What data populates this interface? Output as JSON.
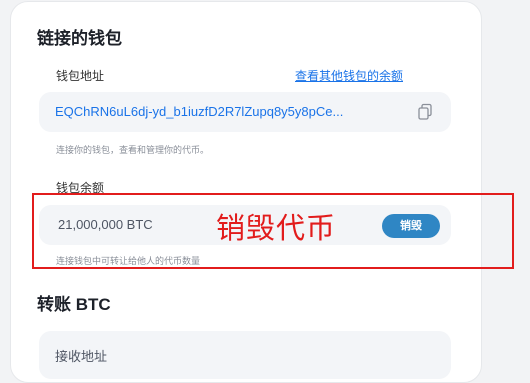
{
  "wallet": {
    "title": "链接的钱包",
    "address_label": "钱包地址",
    "view_other_balance": "查看其他钱包的余额",
    "address": "EQChRN6uL6dj-yd_b1iuzfD2R7lZupq8y5y8pCe...",
    "address_hint": "连接你的钱包，查看和管理你的代币。",
    "balance_label": "钱包余额",
    "balance": "21,000,000 BTC",
    "burn_button": "销毁",
    "balance_hint": "连接钱包中可转让给他人的代币数量"
  },
  "annotation": {
    "text": "销毁代币",
    "color": "#e21c1c"
  },
  "transfer": {
    "title": "转账 BTC",
    "receive_address_placeholder": "接收地址"
  },
  "colors": {
    "accent": "#1a73e8",
    "button": "#2f86c4",
    "field_bg": "#f3f5f8"
  }
}
